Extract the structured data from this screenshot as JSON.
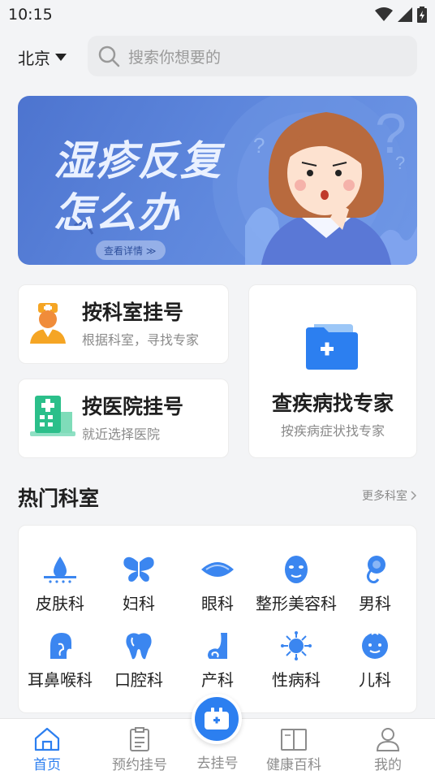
{
  "status": {
    "time": "10:15"
  },
  "header": {
    "city": "北京",
    "search_placeholder": "搜索你想要的"
  },
  "banner": {
    "line1": "湿疹反复",
    "line2": "怎么办",
    "link": "查看详情 ≫"
  },
  "quick": {
    "by_department": {
      "title": "按科室挂号",
      "subtitle": "根据科室，寻找专家"
    },
    "by_hospital": {
      "title": "按医院挂号",
      "subtitle": "就近选择医院"
    },
    "by_disease": {
      "title": "查疾病找专家",
      "subtitle": "按疾病症状找专家"
    }
  },
  "hot": {
    "title": "热门科室",
    "more": "更多科室",
    "departments": [
      {
        "label": "皮肤科",
        "icon": "skin-icon"
      },
      {
        "label": "妇科",
        "icon": "butterfly-icon"
      },
      {
        "label": "眼科",
        "icon": "eye-icon"
      },
      {
        "label": "整形美容科",
        "icon": "face-icon"
      },
      {
        "label": "男科",
        "icon": "male-icon"
      },
      {
        "label": "耳鼻喉科",
        "icon": "head-icon"
      },
      {
        "label": "口腔科",
        "icon": "tooth-icon"
      },
      {
        "label": "产科",
        "icon": "fetus-icon"
      },
      {
        "label": "性病科",
        "icon": "virus-icon"
      },
      {
        "label": "儿科",
        "icon": "baby-icon"
      }
    ]
  },
  "tabbar": {
    "home": "首页",
    "appointment": "预约挂号",
    "register": "去挂号",
    "encyclopedia": "健康百科",
    "mine": "我的"
  },
  "colors": {
    "accent": "#2c7ff0",
    "icon_blue": "#3b86f0",
    "banner_bg": "#5b82d9"
  }
}
